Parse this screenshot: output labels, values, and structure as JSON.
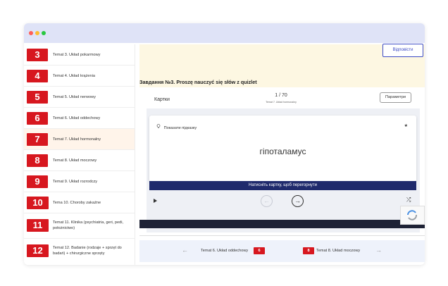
{
  "window": {
    "dots": [
      {
        "name": "close-dot",
        "color": "#ff5f57"
      },
      {
        "name": "minimize-dot",
        "color": "#febc2e"
      },
      {
        "name": "zoom-dot",
        "color": "#28c840"
      }
    ]
  },
  "sidebar": {
    "items": [
      {
        "num": "3",
        "title": "Temat 3. Układ pokarmowy"
      },
      {
        "num": "4",
        "title": "Temat 4. Układ krążenia"
      },
      {
        "num": "5",
        "title": "Temat 5. Układ nerwowy"
      },
      {
        "num": "6",
        "title": "Temat 6. Układ oddechowy"
      },
      {
        "num": "7",
        "title": "Temat 7. Układ hormonalny",
        "active": true
      },
      {
        "num": "8",
        "title": "Temat 8. Układ moczowy"
      },
      {
        "num": "9",
        "title": "Temat 9. Układ rozrodczy"
      },
      {
        "num": "10",
        "title": "Tema 10. Choroby zakaźne"
      },
      {
        "num": "11",
        "title": "Temat 11. Klinika (psychiatria, geri, pedi, położnictwo)"
      },
      {
        "num": "12",
        "title": "Temat 12. Badanie (rodzaje + sprzęt do badań) + chirurgiczne sprzęty"
      }
    ]
  },
  "main": {
    "answers_label": "Відповісти",
    "task_title": "Завдання №3. Proszę nauczyć się słów z quizlet"
  },
  "quizlet": {
    "cards_label": "Картки",
    "counter": "1 / 70",
    "counter_sub": "Temat 7. Układ hormonalny",
    "params_label": "Параметри",
    "hint_label": "Показати підказку",
    "term": "гіпоталамус",
    "flip_label": "Натисніть картку, щоб перегорнути"
  },
  "nav": {
    "prev_label": "Temat 6. Układ oddechowy",
    "prev_num": "6",
    "next_num": "8",
    "next_label": "Temat 8. Układ moczowy"
  },
  "icons": {
    "hint": "lightbulb-icon",
    "star": "star-icon",
    "play": "play-icon",
    "prev": "arrow-left-icon",
    "next": "arrow-right-icon",
    "shuffle": "shuffle-icon",
    "recaptcha": "recaptcha-icon"
  },
  "colors": {
    "accent_red": "#d7171f",
    "navy": "#1f2a6c",
    "link_blue": "#3c4bc5",
    "titlebar": "#dfe3f7"
  }
}
